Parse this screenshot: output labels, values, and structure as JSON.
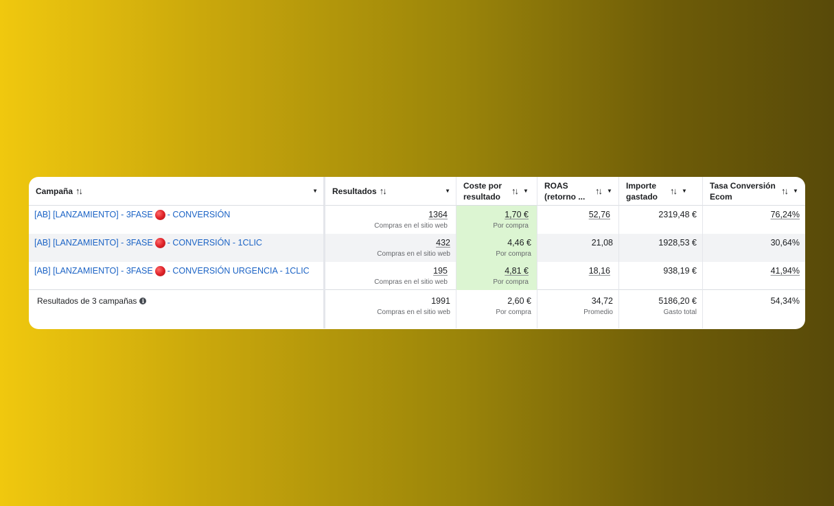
{
  "table": {
    "headers": [
      {
        "label": "Campaña",
        "sort": "↑↓",
        "caret": "▼"
      },
      {
        "label": "Resultados",
        "sort": "↑↓",
        "caret": "▼"
      },
      {
        "label": "Coste por resultado",
        "sort": "↑↓",
        "caret": "▼"
      },
      {
        "label": "ROAS (retorno ...",
        "sort": "↑↓",
        "caret": "▼"
      },
      {
        "label": "Importe gastado",
        "sort": "↑↓",
        "caret": "▼"
      },
      {
        "label": "Tasa Conversión Ecom",
        "sort": "↑↓",
        "caret": "▼"
      }
    ],
    "rows": [
      {
        "campaign_prefix": "[AB] [LANZAMIENTO] - 3FASE",
        "campaign_suffix": "- CONVERSIÓN",
        "results": "1364",
        "results_sub": "Compras en el sitio web",
        "cost": "1,70 €",
        "cost_sub": "Por compra",
        "roas": "52,76",
        "spent": "2319,48 €",
        "rate": "76,24%"
      },
      {
        "campaign_prefix": "[AB] [LANZAMIENTO] - 3FASE",
        "campaign_suffix": "- CONVERSIÓN - 1CLIC",
        "results": "432",
        "results_sub": "Compras en el sitio web",
        "cost": "4,46 €",
        "cost_sub": "Por compra",
        "roas": "21,08",
        "spent": "1928,53 €",
        "rate": "30,64%"
      },
      {
        "campaign_prefix": "[AB] [LANZAMIENTO] - 3FASE",
        "campaign_suffix": "- CONVERSIÓN URGENCIA - 1CLIC",
        "results": "195",
        "results_sub": "Compras en el sitio web",
        "cost": "4,81 €",
        "cost_sub": "Por compra",
        "roas": "18,16",
        "spent": "938,19 €",
        "rate": "41,94%"
      }
    ],
    "total": {
      "label": "Resultados de 3 campañas",
      "info_icon": "i",
      "results": "1991",
      "results_sub": "Compras en el sitio web",
      "cost": "2,60 €",
      "cost_sub": "Por compra",
      "roas": "34,72",
      "roas_sub": "Promedio",
      "spent": "5186,20 €",
      "spent_sub": "Gasto total",
      "rate": "54,34%"
    }
  },
  "colors": {
    "link": "#1b63c5",
    "highlight": "#dcf5d2",
    "status_dot": "#e0242a",
    "background_left": "#f0c80e",
    "background_right": "#584a09"
  }
}
